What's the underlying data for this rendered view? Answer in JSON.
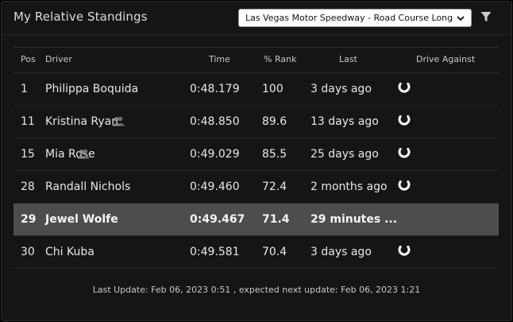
{
  "header": {
    "title": "My Relative Standings",
    "track_select": "Las Vegas Motor Speedway - Road Course Long",
    "filter_icon": "filter-icon"
  },
  "table": {
    "columns": {
      "pos": "Pos",
      "driver": "Driver",
      "time": "Time",
      "rank": "% Rank",
      "last": "Last",
      "drive": "Drive Against"
    },
    "rows": [
      {
        "pos": "1",
        "driver": "Philippa Boquida",
        "time": "0:48.179",
        "rank": "100",
        "last": "3 days ago",
        "friend": false,
        "drive_against": true
      },
      {
        "pos": "11",
        "driver": "Kristina Ryan",
        "time": "0:48.850",
        "rank": "89.6",
        "last": "13 days ago",
        "friend": true,
        "drive_against": true
      },
      {
        "pos": "15",
        "driver": "Mia Rose",
        "time": "0:49.029",
        "rank": "85.5",
        "last": "25 days ago",
        "friend": true,
        "drive_against": true
      },
      {
        "pos": "28",
        "driver": "Randall Nichols",
        "time": "0:49.460",
        "rank": "72.4",
        "last": "2 months ago",
        "friend": false,
        "drive_against": true
      },
      {
        "pos": "29",
        "driver": "Jewel Wolfe",
        "time": "0:49.467",
        "rank": "71.4",
        "last": "29 minutes ...",
        "friend": false,
        "drive_against": false,
        "current_user": true
      },
      {
        "pos": "30",
        "driver": "Chi Kuba",
        "time": "0:49.581",
        "rank": "70.4",
        "last": "3 days ago",
        "friend": false,
        "drive_against": true
      }
    ]
  },
  "footer": {
    "text": "Last Update: Feb 06, 2023 0:51 , expected next update: Feb 06, 2023 1:21"
  },
  "colors": {
    "panel_bg": "#151515",
    "active_row_bg": "#4d4d4d",
    "text": "#e8e8e8"
  }
}
